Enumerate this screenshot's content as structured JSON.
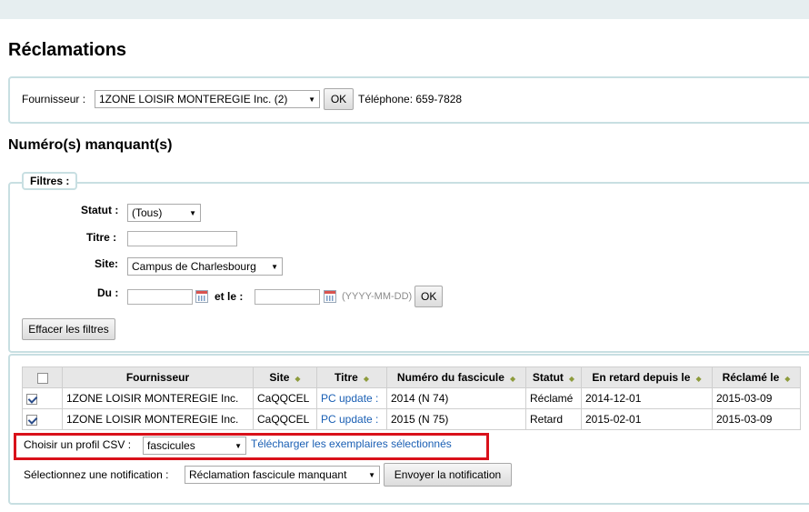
{
  "page": {
    "title": "Réclamations",
    "section_title": "Numéro(s) manquant(s)"
  },
  "vendor": {
    "label": "Fournisseur :",
    "selected": "1ZONE LOISIR MONTEREGIE Inc. (2)",
    "ok_label": "OK",
    "phone": "Téléphone: 659-7828"
  },
  "filters": {
    "legend": "Filtres :",
    "status_label": "Statut :",
    "status_value": "(Tous)",
    "title_label": "Titre :",
    "title_value": "",
    "site_label": "Site:",
    "site_value": "Campus de Charlesbourg",
    "from_label": "Du :",
    "to_label": "et le :",
    "date_hint": "(YYYY-MM-DD)",
    "ok_label": "OK",
    "clear_label": "Effacer les filtres"
  },
  "table": {
    "headers": [
      "Fournisseur",
      "Site",
      "Titre",
      "Numéro du fascicule",
      "Statut",
      "En retard depuis le",
      "Réclamé le"
    ],
    "rows": [
      {
        "checked": true,
        "vendor": "1ZONE LOISIR MONTEREGIE Inc.",
        "site": "CaQQCEL",
        "title": "PC update :",
        "issue": "2014 (N 74)",
        "status": "Réclamé",
        "late_since": "2014-12-01",
        "claimed_on": "2015-03-09"
      },
      {
        "checked": true,
        "vendor": "1ZONE LOISIR MONTEREGIE Inc.",
        "site": "CaQQCEL",
        "title": "PC update :",
        "issue": "2015 (N 75)",
        "status": "Retard",
        "late_since": "2015-02-01",
        "claimed_on": "2015-03-09"
      }
    ]
  },
  "csv": {
    "label": "Choisir un profil CSV :",
    "selected": "fascicules",
    "download_link": "Télécharger les exemplaires sélectionnés"
  },
  "notification": {
    "label": "Sélectionnez une notification :",
    "selected": "Réclamation fascicule manquant",
    "send_label": "Envoyer la notification"
  },
  "colors": {
    "accent_border": "#c8dfe2",
    "link": "#1a5fb4",
    "highlight": "#d9111a"
  }
}
